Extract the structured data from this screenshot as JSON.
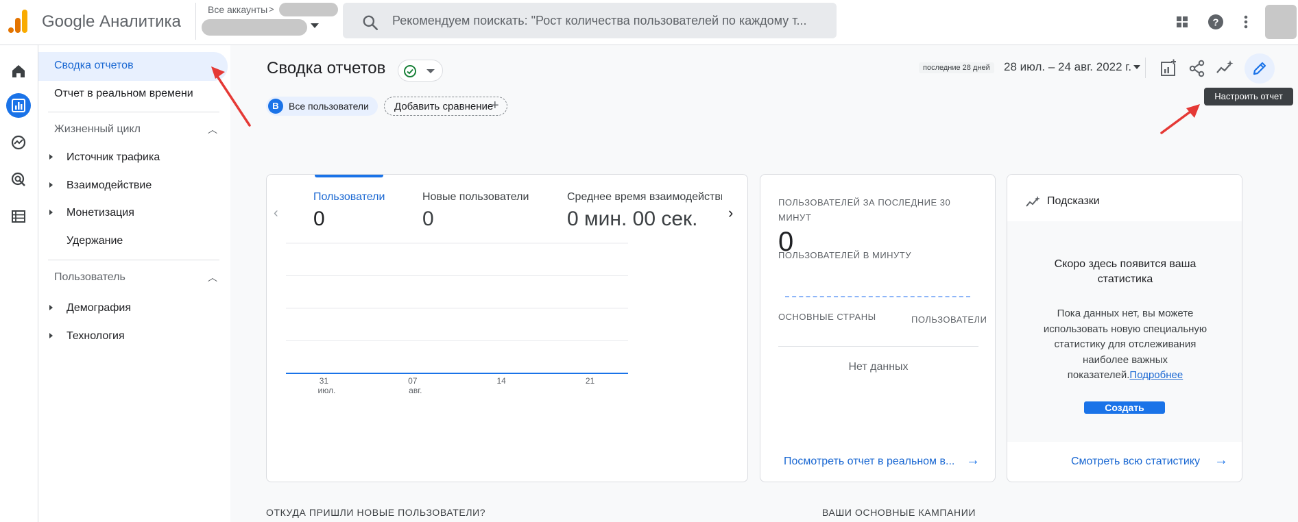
{
  "app": {
    "title": "Google Аналитика"
  },
  "account": {
    "label": "Все аккаунты",
    "chevron": ">"
  },
  "search": {
    "placeholder": "Рекомендуем поискать: \"Рост количества пользователей по каждому т..."
  },
  "sidebar": {
    "items": [
      {
        "label": "Сводка отчетов",
        "active": true
      },
      {
        "label": "Отчет в реальном времени",
        "active": false
      }
    ],
    "sections": [
      {
        "label": "Жизненный цикл",
        "children": [
          "Источник трафика",
          "Взаимодействие",
          "Монетизация",
          "Удержание"
        ]
      },
      {
        "label": "Пользователь",
        "children": [
          "Демография",
          "Технология"
        ]
      }
    ]
  },
  "header": {
    "title": "Сводка отчетов",
    "date_badge": "последние 28 дней",
    "date_range": "28 июл. – 24 авг. 2022 г.",
    "tooltip": "Настроить отчет"
  },
  "comparison": {
    "chip_letter": "В",
    "chip_label": "Все пользователи",
    "add_label": "Добавить сравнение",
    "add_icon": "+"
  },
  "metrics_card": {
    "metrics": [
      {
        "name": "Пользователи",
        "value": "0"
      },
      {
        "name": "Новые пользователи",
        "value": "0"
      },
      {
        "name": "Среднее время взаимодействия",
        "value": "0 мин. 00 сек."
      }
    ],
    "prev_icon": "‹",
    "next_icon": "›"
  },
  "chart_data": {
    "type": "line",
    "title": "",
    "x_ticks": [
      {
        "day": "31",
        "month": "июл."
      },
      {
        "day": "07",
        "month": "авг."
      },
      {
        "day": "14",
        "month": ""
      },
      {
        "day": "21",
        "month": ""
      }
    ],
    "series": [
      {
        "values": [
          0,
          0,
          0,
          0,
          0,
          0,
          0,
          0,
          0,
          0,
          0,
          0,
          0,
          0,
          0,
          0,
          0,
          0,
          0,
          0,
          0,
          0,
          0,
          0,
          0,
          0,
          0,
          0
        ]
      }
    ],
    "ylim": [
      0,
      1
    ],
    "grid": true,
    "color": "#1a73e8"
  },
  "realtime_card": {
    "title": "ПОЛЬЗОВАТЕЛЕЙ ЗА ПОСЛЕДНИЕ 30 МИНУТ",
    "value": "0",
    "subtitle": "ПОЛЬЗОВАТЕЛЕЙ В МИНУТУ",
    "col_countries": "ОСНОВНЫЕ СТРАНЫ",
    "col_users": "ПОЛЬЗОВАТЕЛИ",
    "no_data": "Нет данных",
    "link": "Посмотреть отчет в реальном в...",
    "arrow": "→"
  },
  "insights_card": {
    "title": "Подсказки",
    "heading": "Скоро здесь появится ваша статистика",
    "body": "Пока данных нет, вы можете использовать новую специальную статистику для отслеживания наиболее важных показателей.",
    "learn_more": "Подробнее",
    "create_button": "Создать",
    "link": "Смотреть всю статистику",
    "arrow": "→"
  },
  "sections": {
    "new_users_source": "ОТКУДА ПРИШЛИ НОВЫЕ ПОЛЬЗОВАТЕЛИ?",
    "top_campaigns": "ВАШИ ОСНОВНЫЕ КАМПАНИИ"
  },
  "colors": {
    "accent": "#1a73e8",
    "logo_orange": "#f9ab00",
    "logo_dark_orange": "#e37400",
    "check_green": "#188038",
    "annotation_red": "#e53935"
  }
}
